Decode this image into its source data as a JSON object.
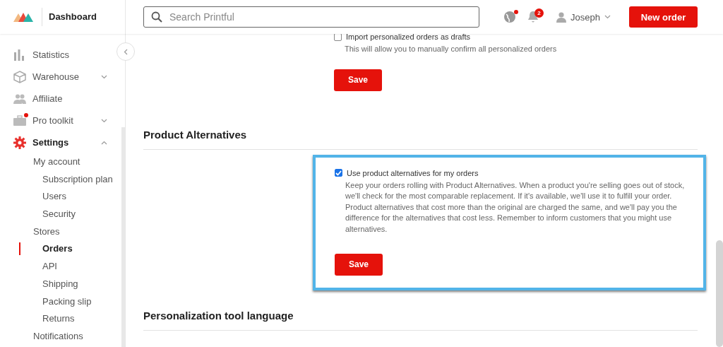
{
  "header": {
    "title": "Dashboard",
    "search": {
      "placeholder": "Search Printful"
    },
    "globe_alert": true,
    "notifications": "2",
    "user": "Joseph",
    "new_order": "New order"
  },
  "sidebar": {
    "items": [
      {
        "label": "Statistics",
        "selected": false
      },
      {
        "label": "Warehouse",
        "expanded": false,
        "selected": false
      },
      {
        "label": "Affiliate",
        "selected": false
      },
      {
        "label": "Pro toolkit",
        "expanded": false,
        "alert": true,
        "selected": false
      },
      {
        "label": "Settings",
        "expanded": true,
        "selected": true,
        "children": [
          {
            "label": "My account",
            "selected": false,
            "children": [
              {
                "label": "Subscription plan",
                "selected": false
              },
              {
                "label": "Users",
                "selected": false
              },
              {
                "label": "Security",
                "selected": false
              }
            ]
          },
          {
            "label": "Stores",
            "selected": false,
            "children": [
              {
                "label": "Orders",
                "selected": true
              },
              {
                "label": "API",
                "selected": false
              },
              {
                "label": "Shipping",
                "selected": false
              },
              {
                "label": "Packing slip",
                "selected": false
              },
              {
                "label": "Returns",
                "selected": false
              }
            ]
          },
          {
            "label": "Notifications",
            "selected": false
          }
        ]
      }
    ]
  },
  "sections": [
    {
      "option": {
        "label": "Import personalized orders as drafts",
        "checked": false,
        "description": "This will allow you to manually confirm all personalized orders"
      },
      "save": "Save"
    },
    {
      "heading": "Product Alternatives",
      "highlighted": true,
      "option": {
        "label": "Use product alternatives for my orders",
        "checked": true,
        "description": "Keep your orders rolling with Product Alternatives. When a product you're selling goes out of stock, we'll check for the most comparable replacement. If it's available, we'll use it to fulfill your order. Product alternatives that cost more than the original are charged the same, and we'll pay you the difference for the alternatives that cost less. Remember to inform customers that you might use alternatives."
      },
      "save": "Save"
    },
    {
      "heading": "Personalization tool language"
    }
  ]
}
